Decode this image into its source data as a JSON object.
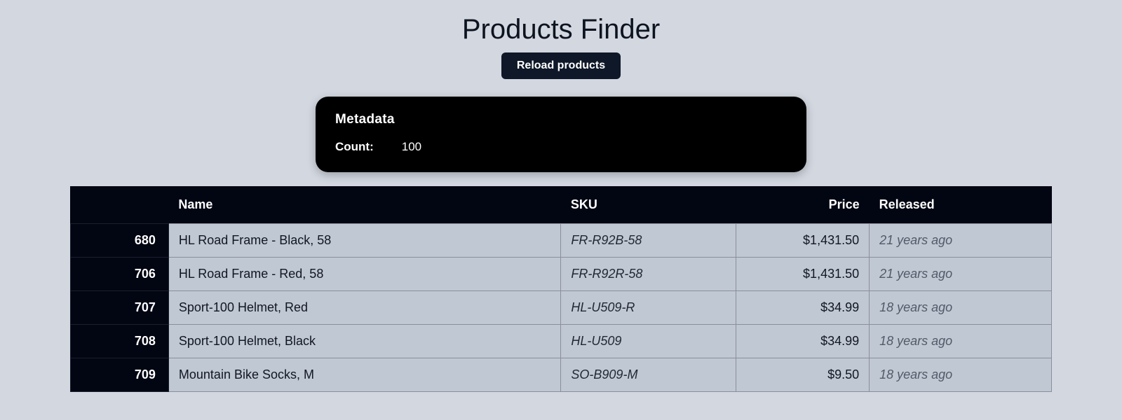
{
  "header": {
    "title": "Products Finder",
    "reload_button": "Reload products"
  },
  "metadata": {
    "heading": "Metadata",
    "count_label": "Count:",
    "count_value": "100"
  },
  "table": {
    "headers": {
      "id": "",
      "name": "Name",
      "sku": "SKU",
      "price": "Price",
      "released": "Released"
    },
    "rows": [
      {
        "id": "680",
        "name": "HL Road Frame - Black, 58",
        "sku": "FR-R92B-58",
        "price": "$1,431.50",
        "released": "21 years ago"
      },
      {
        "id": "706",
        "name": "HL Road Frame - Red, 58",
        "sku": "FR-R92R-58",
        "price": "$1,431.50",
        "released": "21 years ago"
      },
      {
        "id": "707",
        "name": "Sport-100 Helmet, Red",
        "sku": "HL-U509-R",
        "price": "$34.99",
        "released": "18 years ago"
      },
      {
        "id": "708",
        "name": "Sport-100 Helmet, Black",
        "sku": "HL-U509",
        "price": "$34.99",
        "released": "18 years ago"
      },
      {
        "id": "709",
        "name": "Mountain Bike Socks, M",
        "sku": "SO-B909-M",
        "price": "$9.50",
        "released": "18 years ago"
      }
    ]
  }
}
